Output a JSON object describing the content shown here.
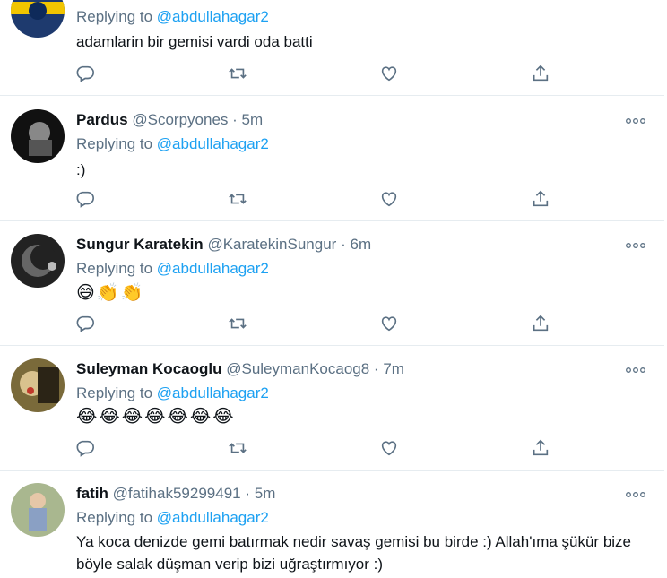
{
  "replying_prefix": "Replying to",
  "tweets": [
    {
      "name": "",
      "handle": "",
      "time": "",
      "reply_to": "@abdullahagar2",
      "text": "adamlarin bir gemisi vardi oda batti",
      "emoji": ""
    },
    {
      "name": "Pardus",
      "handle": "@Scorpyones",
      "time": "5m",
      "reply_to": "@abdullahagar2",
      "text": ":)",
      "emoji": ""
    },
    {
      "name": "Sungur Karatekin",
      "handle": "@KaratekinSungur",
      "time": "6m",
      "reply_to": "@abdullahagar2",
      "text": "",
      "emoji": "😅👏👏"
    },
    {
      "name": "Suleyman Kocaoglu",
      "handle": "@SuleymanKocaog8",
      "time": "7m",
      "reply_to": "@abdullahagar2",
      "text": "",
      "emoji": "😂😂😂😂😂😂😂"
    },
    {
      "name": "fatih",
      "handle": "@fatihak59299491",
      "time": "5m",
      "reply_to": "@abdullahagar2",
      "text": "Ya koca denizde gemi batırmak nedir savaş gemisi bu birde :) Allah'ıma şükür bize böyle salak düşman verip bizi uğraştırmıyor :)",
      "emoji": ""
    }
  ],
  "separator": "·",
  "colors": {
    "link": "#1da1f2",
    "secondary": "#5b7083",
    "border": "#e6ecf0",
    "text": "#0f1419"
  },
  "icons": [
    "reply-icon",
    "retweet-icon",
    "like-icon",
    "share-icon",
    "more-icon"
  ]
}
